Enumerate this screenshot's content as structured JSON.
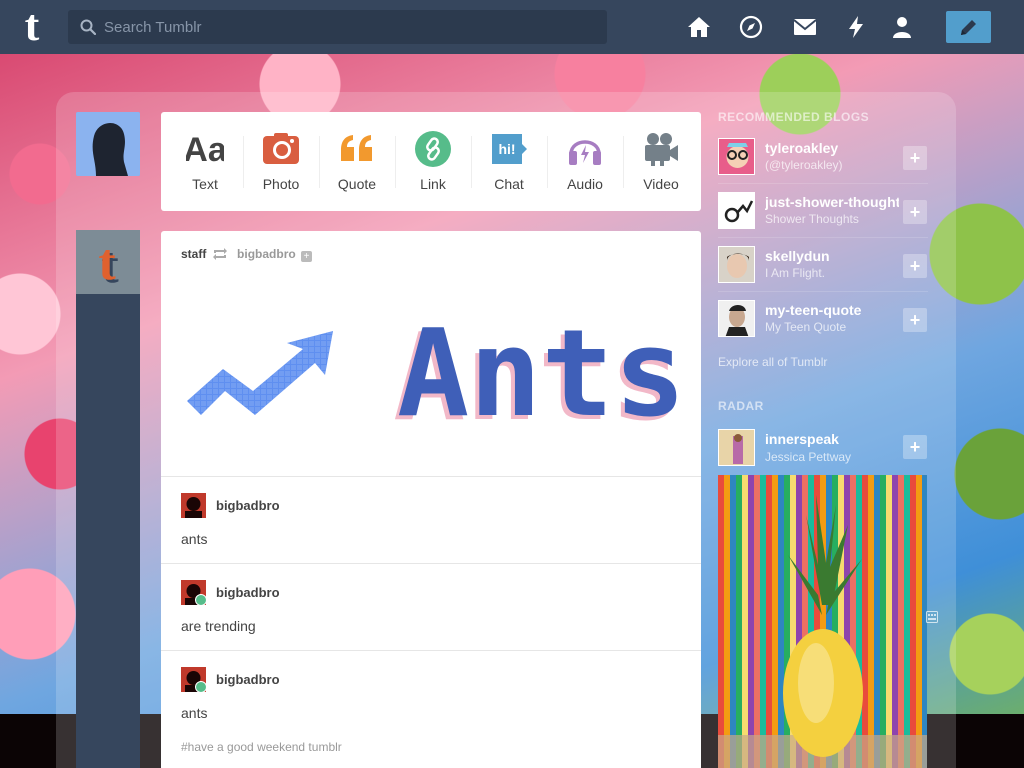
{
  "header": {
    "logo_glyph": "t",
    "search_placeholder": "Search Tumblr",
    "nav": [
      "home-icon",
      "explore-icon",
      "inbox-icon",
      "activity-icon",
      "account-icon"
    ],
    "compose_icon": "pencil-icon",
    "bar_color": "#36465d",
    "compose_color": "#529ecc"
  },
  "post_types": [
    {
      "label": "Text",
      "icon": "text-icon",
      "color": "#444444"
    },
    {
      "label": "Photo",
      "icon": "photo-icon",
      "color": "#d95e40"
    },
    {
      "label": "Quote",
      "icon": "quote-icon",
      "color": "#f2992e"
    },
    {
      "label": "Link",
      "icon": "link-icon",
      "color": "#56bc8a"
    },
    {
      "label": "Chat",
      "icon": "chat-icon",
      "color": "#529ecc"
    },
    {
      "label": "Audio",
      "icon": "audio-icon",
      "color": "#a77dc2"
    },
    {
      "label": "Video",
      "icon": "video-icon",
      "color": "#748089"
    }
  ],
  "post": {
    "author": "staff",
    "reblogged_from": "bigbadbro",
    "follow_glyph": "+",
    "image_text": "Ants",
    "trail": [
      {
        "name": "bigbadbro",
        "body": "ants"
      },
      {
        "name": "bigbadbro",
        "body": "are trending"
      },
      {
        "name": "bigbadbro",
        "body": "ants"
      }
    ],
    "tags": "#have a good weekend tumblr"
  },
  "sidebar": {
    "recommended_title": "RECOMMENDED BLOGS",
    "recommended": [
      {
        "name": "tyleroakley",
        "sub": "(@tyleroakley)"
      },
      {
        "name": "just-shower-thoughts",
        "sub": "Shower Thoughts"
      },
      {
        "name": "skellydun",
        "sub": "I Am Flight."
      },
      {
        "name": "my-teen-quote",
        "sub": "My Teen Quote"
      }
    ],
    "explore": "Explore all of Tumblr",
    "radar_title": "RADAR",
    "radar": {
      "name": "innerspeak",
      "sub": "Jessica Pettway"
    },
    "follow_glyph": "+"
  }
}
